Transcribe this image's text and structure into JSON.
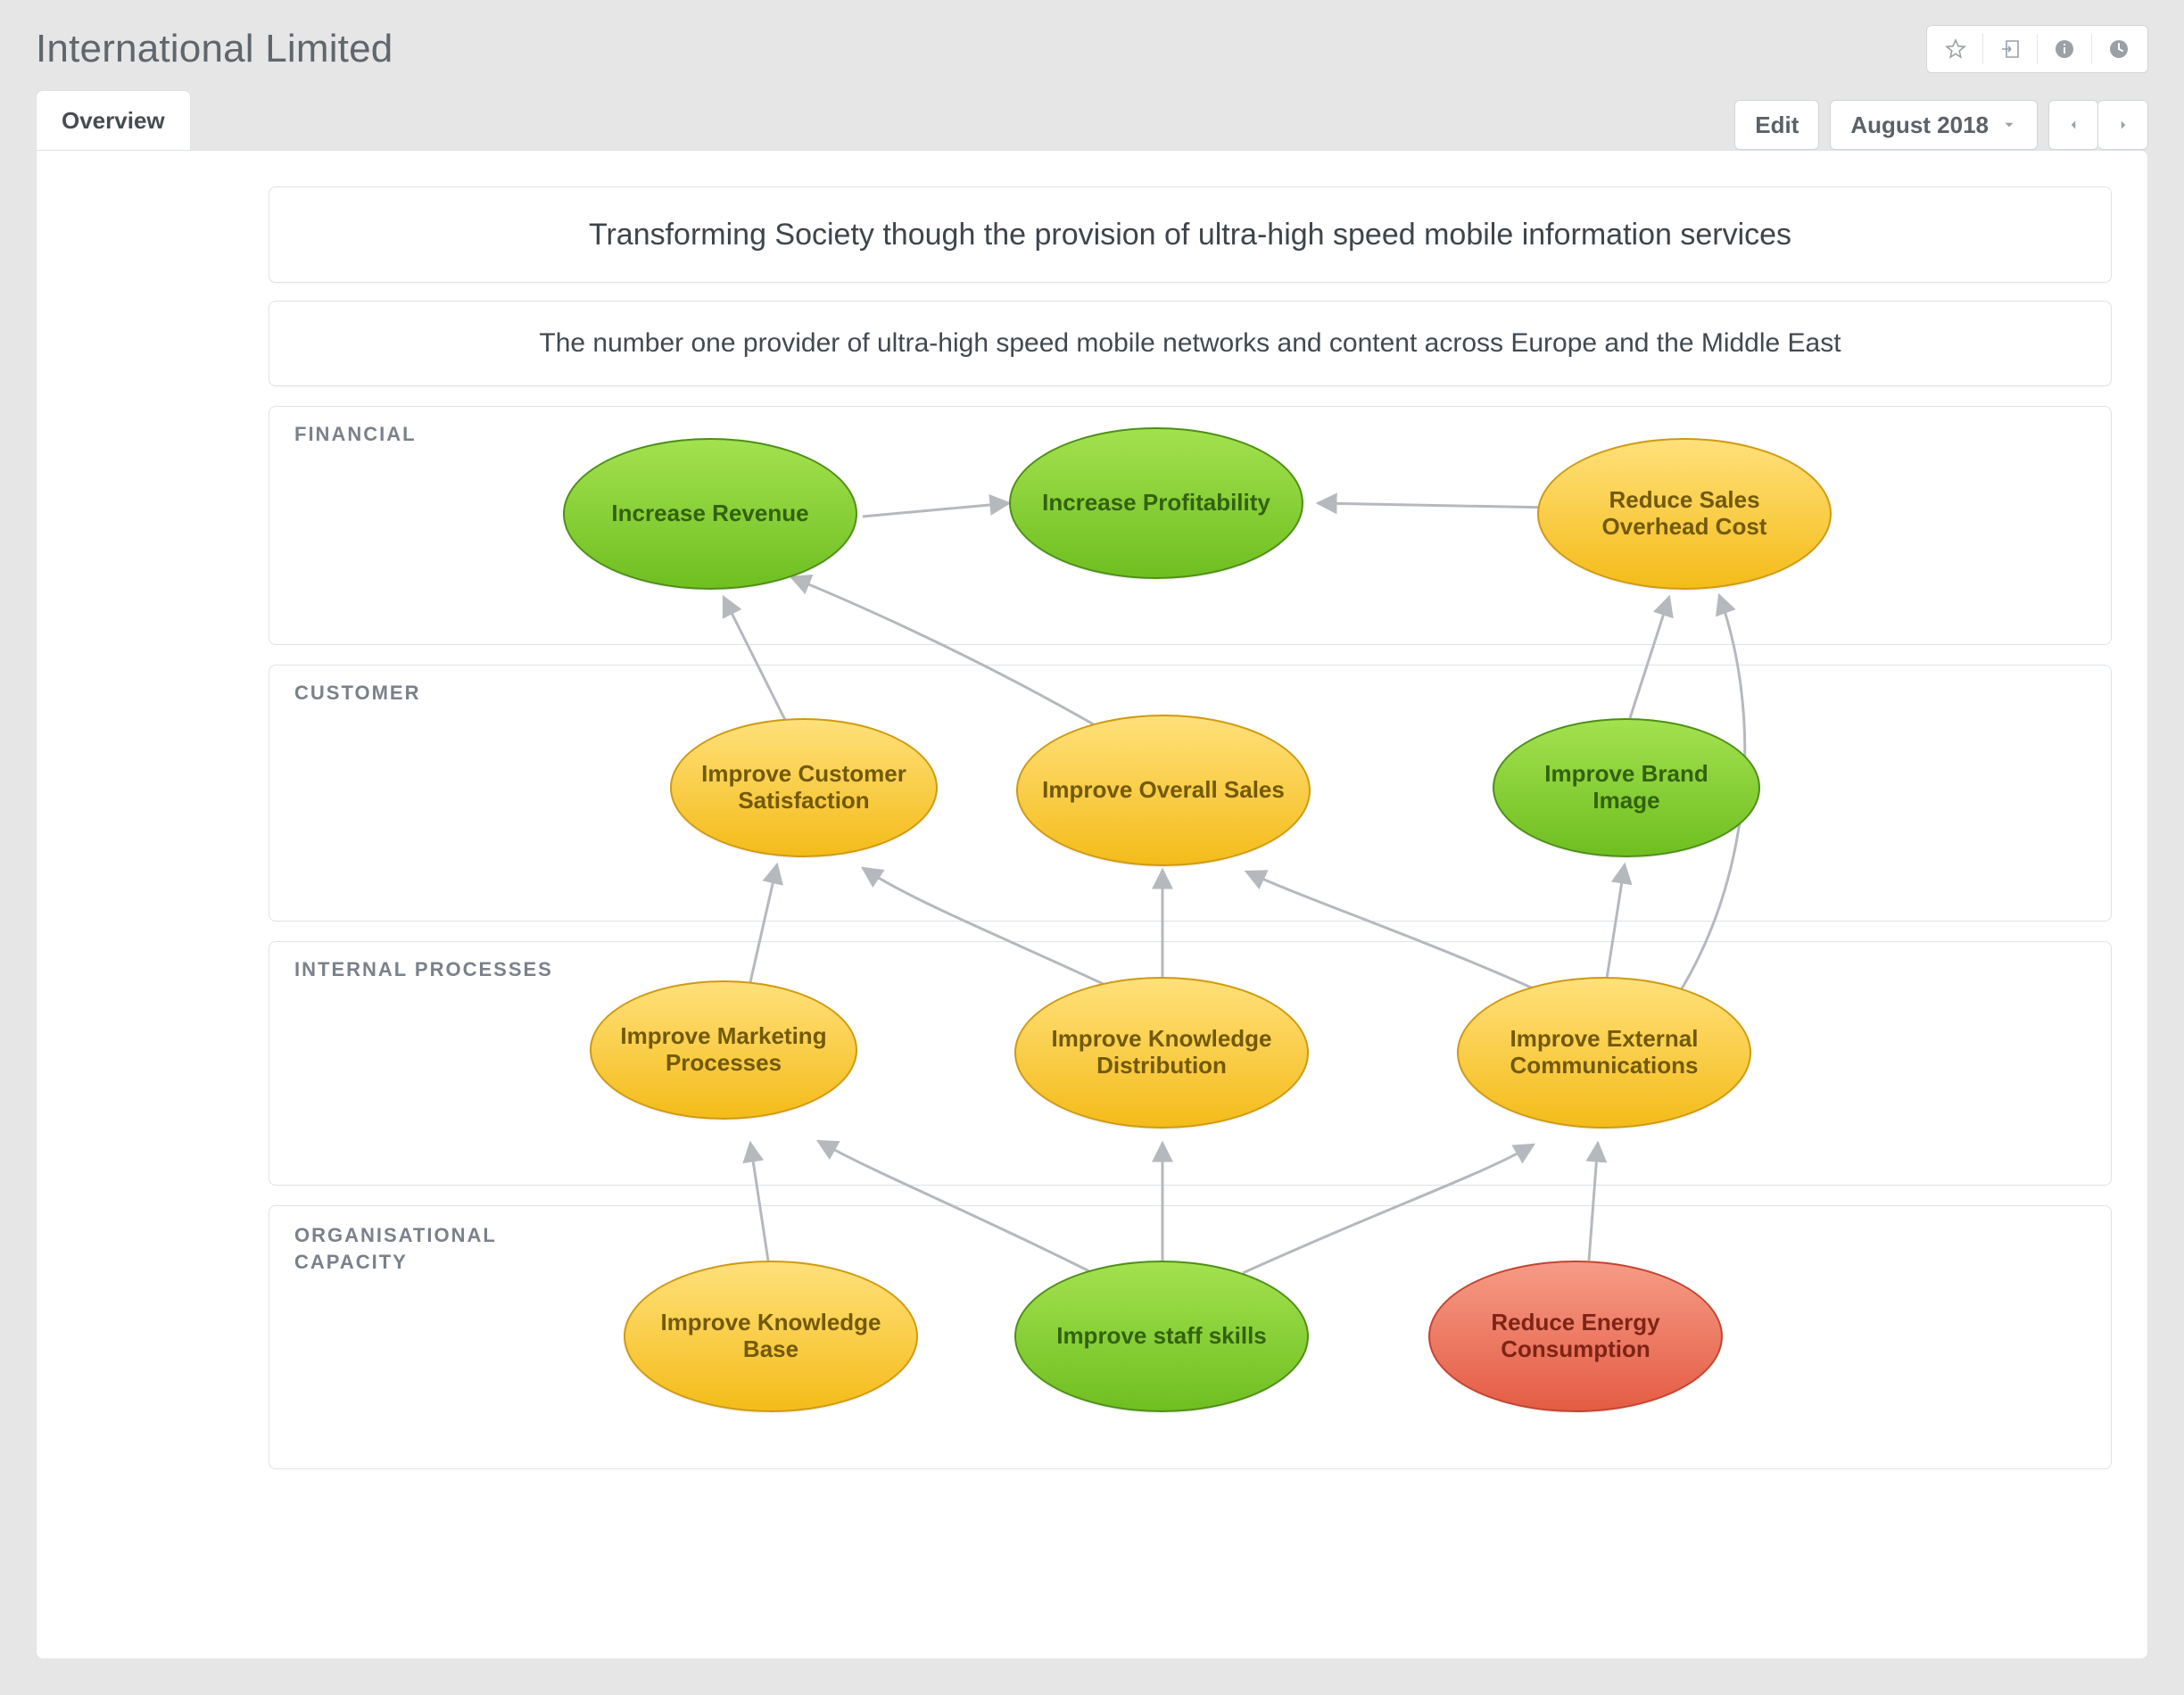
{
  "header": {
    "title": "International Limited",
    "actions": {
      "star_tooltip": "Favorite",
      "export_tooltip": "Export",
      "info_tooltip": "Info",
      "history_tooltip": "History"
    }
  },
  "tabs": {
    "items": [
      {
        "label": "Overview",
        "active": true
      }
    ]
  },
  "controls": {
    "edit_label": "Edit",
    "period_label": "August 2018"
  },
  "diagram": {
    "title": "Transforming Society though the provision of ultra-high speed mobile information services",
    "subtitle": "The number one provider of ultra-high speed mobile networks and content across Europe and the Middle East",
    "sections": {
      "financial": "FINANCIAL",
      "customer": "CUSTOMER",
      "internal": "INTERNAL PROCESSES",
      "organisational": "ORGANISATIONAL CAPACITY"
    },
    "nodes": {
      "increase_revenue": {
        "label": "Increase Revenue",
        "color": "green",
        "section": "financial"
      },
      "increase_profitability": {
        "label": "Increase Profitability",
        "color": "green",
        "section": "financial"
      },
      "reduce_sales_overhead": {
        "label": "Reduce Sales Overhead Cost",
        "color": "yellow",
        "section": "financial"
      },
      "improve_customer_satisfaction": {
        "label": "Improve Customer Satisfaction",
        "color": "yellow",
        "section": "customer"
      },
      "improve_overall_sales": {
        "label": "Improve Overall Sales",
        "color": "yellow",
        "section": "customer"
      },
      "improve_brand_image": {
        "label": "Improve Brand Image",
        "color": "green",
        "section": "customer"
      },
      "improve_marketing_processes": {
        "label": "Improve Marketing Processes",
        "color": "yellow",
        "section": "internal"
      },
      "improve_knowledge_distribution": {
        "label": "Improve Knowledge Distribution",
        "color": "yellow",
        "section": "internal"
      },
      "improve_external_communications": {
        "label": "Improve External Communications",
        "color": "yellow",
        "section": "internal"
      },
      "improve_knowledge_base": {
        "label": "Improve Knowledge Base",
        "color": "yellow",
        "section": "organisational"
      },
      "improve_staff_skills": {
        "label": "Improve staff skills",
        "color": "green",
        "section": "organisational"
      },
      "reduce_energy_consumption": {
        "label": "Reduce Energy Consumption",
        "color": "red",
        "section": "organisational"
      }
    },
    "links": [
      [
        "increase_revenue",
        "increase_profitability"
      ],
      [
        "reduce_sales_overhead",
        "increase_profitability"
      ],
      [
        "improve_customer_satisfaction",
        "increase_revenue"
      ],
      [
        "improve_overall_sales",
        "increase_revenue"
      ],
      [
        "improve_brand_image",
        "reduce_sales_overhead"
      ],
      [
        "improve_marketing_processes",
        "improve_customer_satisfaction"
      ],
      [
        "improve_knowledge_distribution",
        "improve_customer_satisfaction"
      ],
      [
        "improve_knowledge_distribution",
        "improve_overall_sales"
      ],
      [
        "improve_external_communications",
        "improve_overall_sales"
      ],
      [
        "improve_external_communications",
        "improve_brand_image"
      ],
      [
        "improve_knowledge_base",
        "improve_marketing_processes"
      ],
      [
        "improve_staff_skills",
        "improve_marketing_processes"
      ],
      [
        "improve_staff_skills",
        "improve_knowledge_distribution"
      ],
      [
        "improve_staff_skills",
        "improve_external_communications"
      ],
      [
        "reduce_energy_consumption",
        "improve_external_communications"
      ],
      [
        "improve_external_communications",
        "reduce_sales_overhead"
      ]
    ]
  }
}
